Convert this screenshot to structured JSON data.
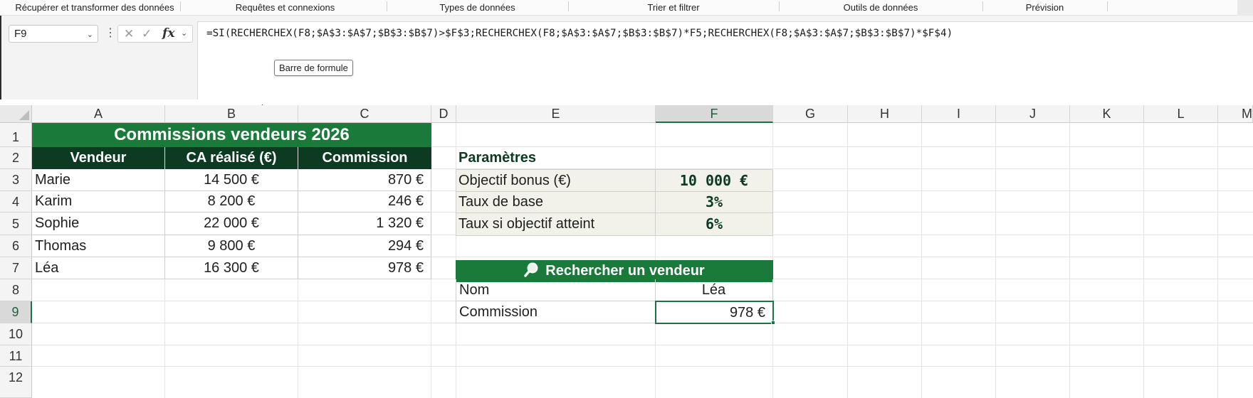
{
  "ribbon": {
    "groups": [
      "Récupérer et transformer des données",
      "Requêtes et connexions",
      "Types de données",
      "Trier et filtrer",
      "Outils de données",
      "Prévision"
    ]
  },
  "formula_bar": {
    "name_box": "F9",
    "formula": "=SI(RECHERCHEX(F8;$A$3:$A$7;$B$3:$B$7)>$F$3;RECHERCHEX(F8;$A$3:$A$7;$B$3:$B$7)*F5;RECHERCHEX(F8;$A$3:$A$7;$B$3:$B$7)*$F$4)",
    "tooltip": "Barre de formule",
    "fx_icon": "fx-icon",
    "cancel_icon": "close-icon",
    "enter_icon": "check-icon"
  },
  "columns": [
    "A",
    "B",
    "C",
    "D",
    "E",
    "F",
    "G",
    "H",
    "I",
    "J",
    "K",
    "L",
    "M"
  ],
  "rows": [
    "1",
    "2",
    "3",
    "4",
    "5",
    "6",
    "7",
    "8",
    "9",
    "10",
    "11",
    "12"
  ],
  "selected_cell": {
    "column": "F",
    "row": "9"
  },
  "sales_table": {
    "title": "Commissions vendeurs 2026",
    "headers": [
      "Vendeur",
      "CA réalisé (€)",
      "Commission"
    ],
    "rows": [
      [
        "Marie",
        "14 500 €",
        "870 €"
      ],
      [
        "Karim",
        "8 200 €",
        "246 €"
      ],
      [
        "Sophie",
        "22 000 €",
        "1 320 €"
      ],
      [
        "Thomas",
        "9 800 €",
        "294 €"
      ],
      [
        "Léa",
        "16 300 €",
        "978 €"
      ]
    ]
  },
  "parameters": {
    "title": "Paramètres",
    "rows": [
      [
        "Objectif bonus (€)",
        "10 000 €"
      ],
      [
        "Taux de base",
        "3%"
      ],
      [
        "Taux si objectif atteint",
        "6%"
      ]
    ]
  },
  "lookup": {
    "title": "Rechercher un vendeur",
    "icon": "magnifier-icon",
    "rows": [
      [
        "Nom",
        "Léa"
      ],
      [
        "Commission",
        "978 €"
      ]
    ]
  },
  "colors": {
    "title_green": "#197a3a",
    "header_dark_green": "#0c3b22",
    "selection_green": "#1e7145"
  }
}
